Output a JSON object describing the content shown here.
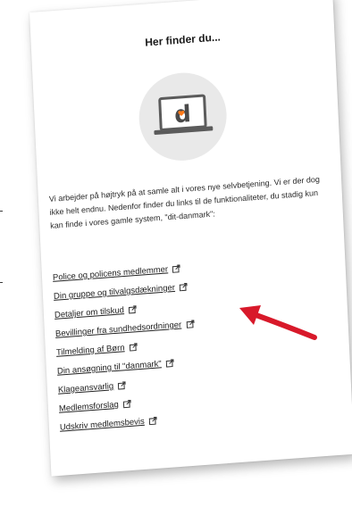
{
  "card": {
    "title": "Her finder du...",
    "intro": "Vi arbejder på højtryk på at samle alt i vores nye selvbetjening. Vi er der dog ikke helt endnu. Nedenfor finder du links til de funktionaliteter, du stadig kun kan finde i vores gamle system, \"dit-danmark\":",
    "hero_icon": "laptop-icon",
    "hero_letter": "d",
    "links": [
      {
        "label": "Police og policens medlemmer",
        "icon": "external-link-icon"
      },
      {
        "label": "Din gruppe og tilvalgsdækninger",
        "icon": "external-link-icon"
      },
      {
        "label": "Detaljer om tilskud",
        "icon": "external-link-icon"
      },
      {
        "label": "Bevillinger fra sundhedsordninger",
        "icon": "external-link-icon"
      },
      {
        "label": "Tilmelding af Børn",
        "icon": "external-link-icon"
      },
      {
        "label": "Din ansøgning til \"danmark\"",
        "icon": "external-link-icon"
      },
      {
        "label": "Klageansvarlig",
        "icon": "external-link-icon"
      },
      {
        "label": "Medlemsforslag",
        "icon": "external-link-icon"
      },
      {
        "label": "Udskriv medlemsbevis",
        "icon": "external-link-icon"
      }
    ]
  },
  "annotation": {
    "icon": "arrow-icon",
    "color": "#d8192a"
  },
  "colors": {
    "text": "#222222",
    "circle": "#e9e9e9",
    "laptop_frame": "#5b5b5b",
    "heart": "#ff7a1a"
  }
}
